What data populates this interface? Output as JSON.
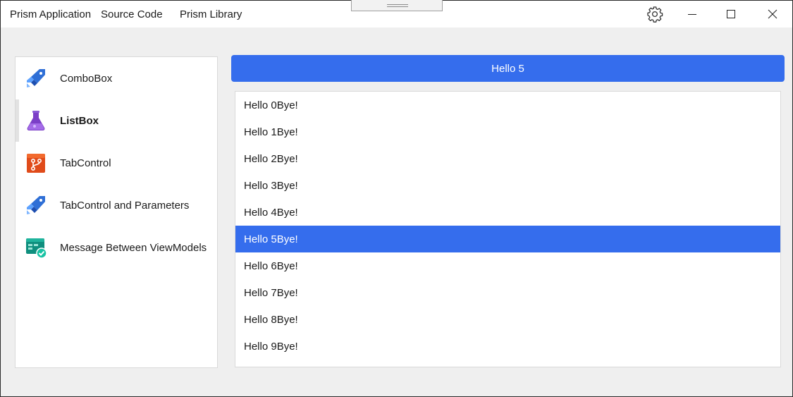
{
  "titlebar": {
    "menu": [
      "Prism Application",
      "Source Code",
      "Prism Library"
    ],
    "settings_icon": "gear-icon",
    "minimize_icon": "minimize-icon",
    "maximize_icon": "maximize-icon",
    "close_icon": "close-icon"
  },
  "nav": {
    "items": [
      {
        "label": "ComboBox",
        "icon": "pipelines-icon"
      },
      {
        "label": "ListBox",
        "icon": "flask-icon",
        "selected": true
      },
      {
        "label": "TabControl",
        "icon": "repo-icon"
      },
      {
        "label": "TabControl and Parameters",
        "icon": "pipelines-icon"
      },
      {
        "label": "Message Between ViewModels",
        "icon": "boards-check-icon"
      }
    ]
  },
  "main": {
    "button_label": "Hello 5",
    "list": [
      "Hello 0Bye!",
      "Hello 1Bye!",
      "Hello 2Bye!",
      "Hello 3Bye!",
      "Hello 4Bye!",
      "Hello 5Bye!",
      "Hello 6Bye!",
      "Hello 7Bye!",
      "Hello 8Bye!",
      "Hello 9Bye!"
    ],
    "selected_index": 5
  },
  "colors": {
    "accent": "#356ded",
    "background": "#efefef"
  }
}
